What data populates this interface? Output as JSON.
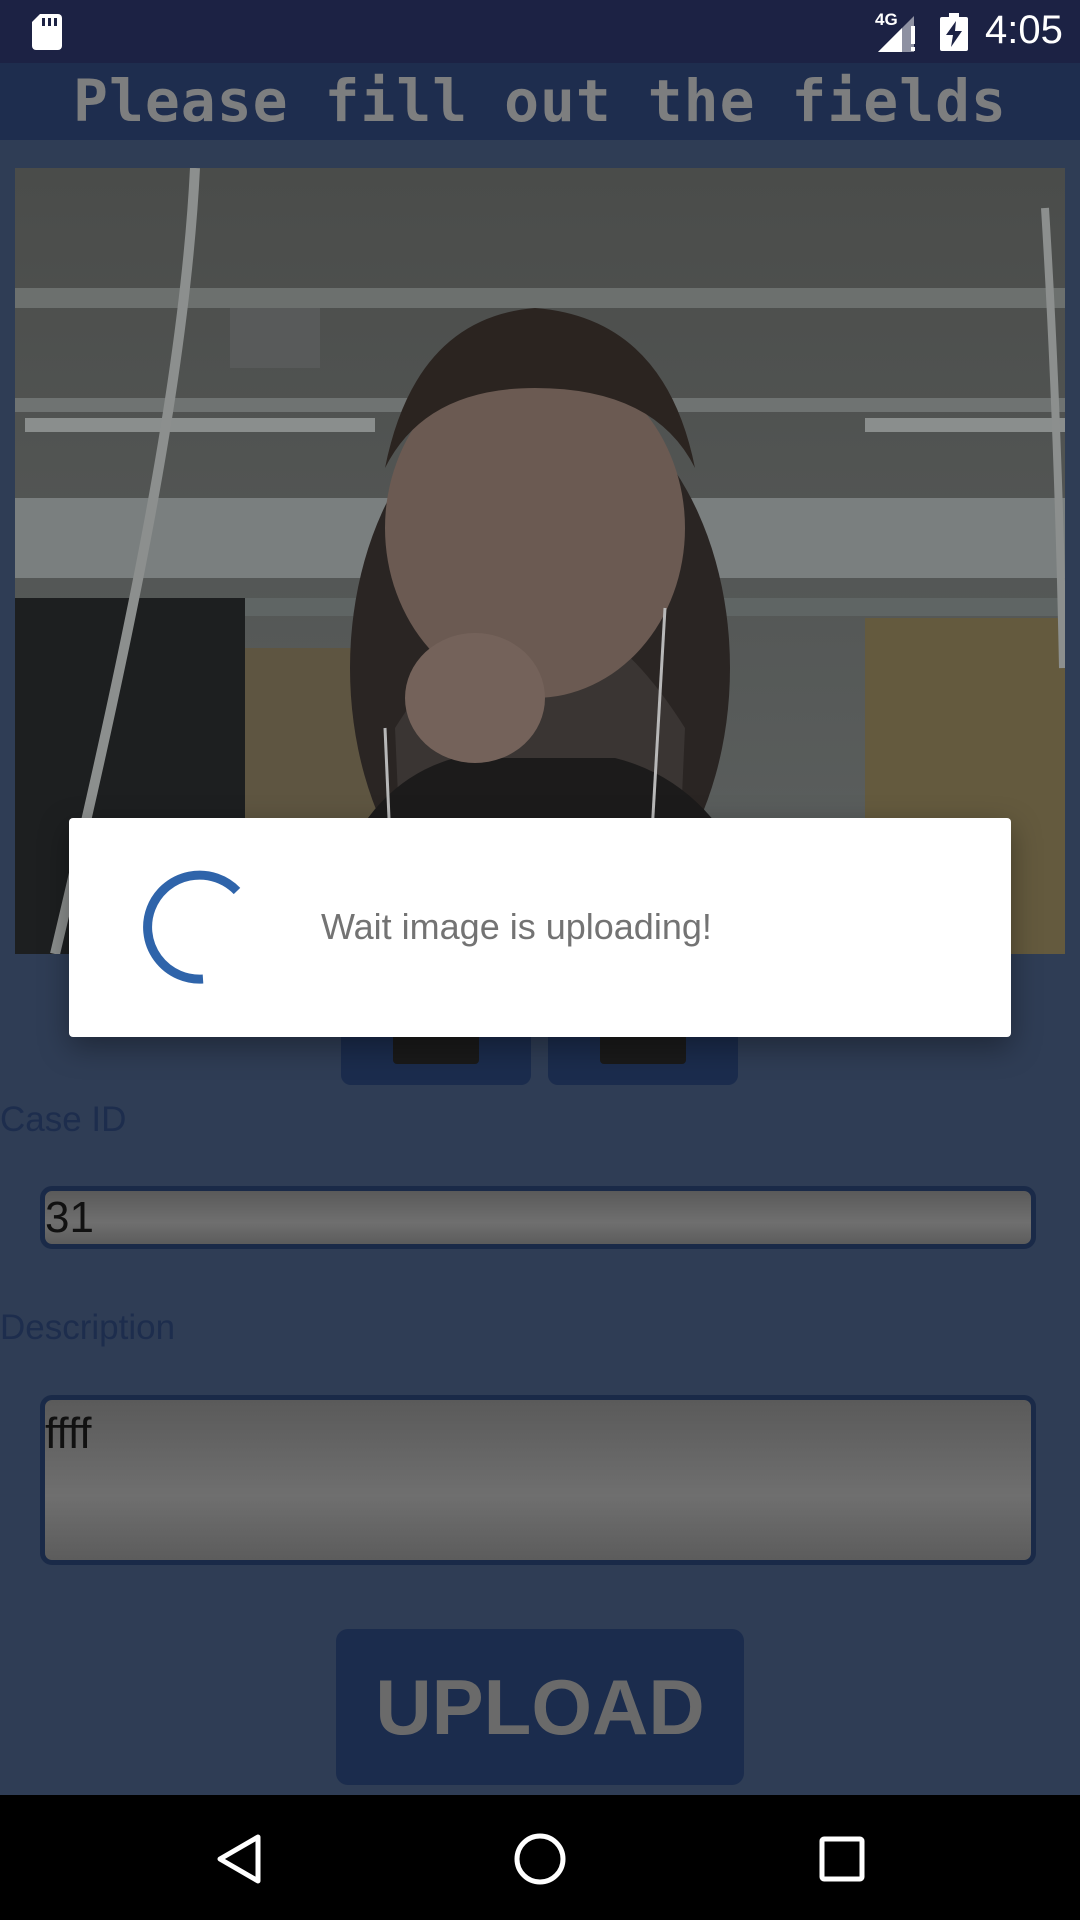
{
  "status_bar": {
    "time": "4:05",
    "network_label": "4G",
    "icons": [
      "sd-card-icon",
      "signal-icon",
      "battery-charging-icon"
    ]
  },
  "header": {
    "title": "Please fill out the fields"
  },
  "photo": {
    "icon": "captured-photo"
  },
  "photo_buttons": [
    {
      "icon": "camera-icon"
    },
    {
      "icon": "gallery-icon"
    }
  ],
  "form": {
    "case_id_label": "Case ID",
    "case_id_value": "31",
    "description_label": "Description",
    "description_value": "ffff"
  },
  "upload_button": {
    "label": "UPLOAD"
  },
  "dialog": {
    "message": "Wait image is uploading!",
    "spinner_color": "#2f64aa"
  },
  "nav_bar": {
    "icons": [
      "back-icon",
      "home-icon",
      "recents-icon"
    ]
  },
  "colors": {
    "status_bar": "#1c2244",
    "primary_dark": "#1b2c4d",
    "scrim_background": "#2f3d55",
    "dialog_background": "#ffffff"
  }
}
